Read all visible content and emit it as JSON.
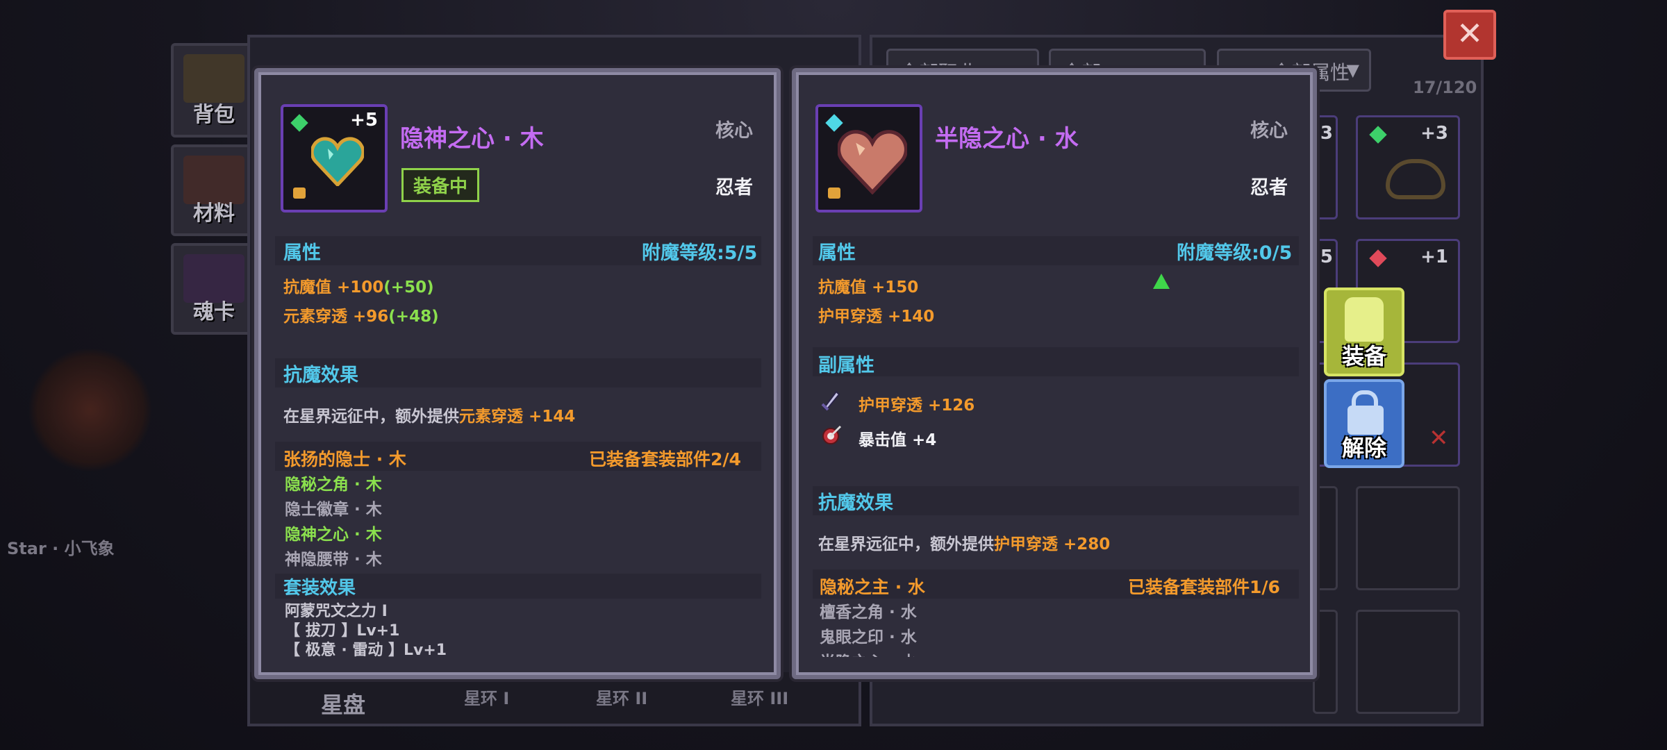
{
  "side_tabs": [
    "背包",
    "材料",
    "魂卡"
  ],
  "filters": [
    "全部职业",
    "全部",
    "全部属性"
  ],
  "inventory_count": "17/120",
  "inventory": [
    {
      "partial": "3"
    },
    {
      "level": "+3"
    },
    {
      "partial": "5"
    },
    {
      "level": "+1"
    }
  ],
  "bottom_bar": {
    "title": "星盘",
    "rings": [
      "星环 I",
      "星环 II",
      "星环 III"
    ]
  },
  "character_name": "Star · 小飞象",
  "card_left": {
    "level": "+5",
    "name": "隐神之心 · 木",
    "slot_type": "核心",
    "equipped_label": "装备中",
    "class_label": "忍者",
    "attr_title": "属性",
    "enchant": "附魔等级:5/5",
    "stats": [
      {
        "label": "抗魔值 +100",
        "bonus": "(+50)"
      },
      {
        "label": "元素穿透 +96",
        "bonus": "(+48)"
      }
    ],
    "effect_title": "抗魔效果",
    "effect_prefix": "在星界远征中，额外提供",
    "effect_value": "元素穿透 +144",
    "set_name": "张扬的隐士 · 木",
    "set_progress": "已装备套装部件2/4",
    "set_pieces": [
      {
        "name": "隐秘之角 · 木",
        "owned": true
      },
      {
        "name": "隐士徽章 · 木",
        "owned": false
      },
      {
        "name": "隐神之心 · 木",
        "owned": true
      },
      {
        "name": "神隐腰带 · 木",
        "owned": false
      }
    ],
    "set_effect_title": "套装效果",
    "set_effect_lines": [
      "阿蒙咒文之力 I",
      "【 拔刀 】Lv+1",
      "【 极意 · 雷动 】Lv+1"
    ]
  },
  "card_right": {
    "name": "半隐之心 · 水",
    "slot_type": "核心",
    "class_label": "忍者",
    "attr_title": "属性",
    "enchant": "附魔等级:0/5",
    "stats": [
      "抗魔值 +150",
      "护甲穿透 +140"
    ],
    "sub_title": "副属性",
    "sub_stats": [
      {
        "label": "护甲穿透 +126",
        "icon": "dagger-icon"
      },
      {
        "label": "暴击值 +4",
        "icon": "crit-target-icon"
      }
    ],
    "effect_title": "抗魔效果",
    "effect_prefix": "在星界远征中，额外提供",
    "effect_value": "护甲穿透 +280",
    "set_name": "隐秘之主 · 水",
    "set_progress": "已装备套装部件1/6",
    "set_pieces": [
      "檀香之角 · 水",
      "鬼眼之印 · 水",
      "半隐之心 · 水"
    ]
  },
  "buttons": {
    "equip": "装备",
    "unequip": "解除",
    "close": "✕"
  },
  "colors": {
    "name_purple": "#c46cf2",
    "section_cyan": "#52c8ea",
    "stat_orange": "#f39a2c",
    "bonus_green": "#8be04e"
  }
}
